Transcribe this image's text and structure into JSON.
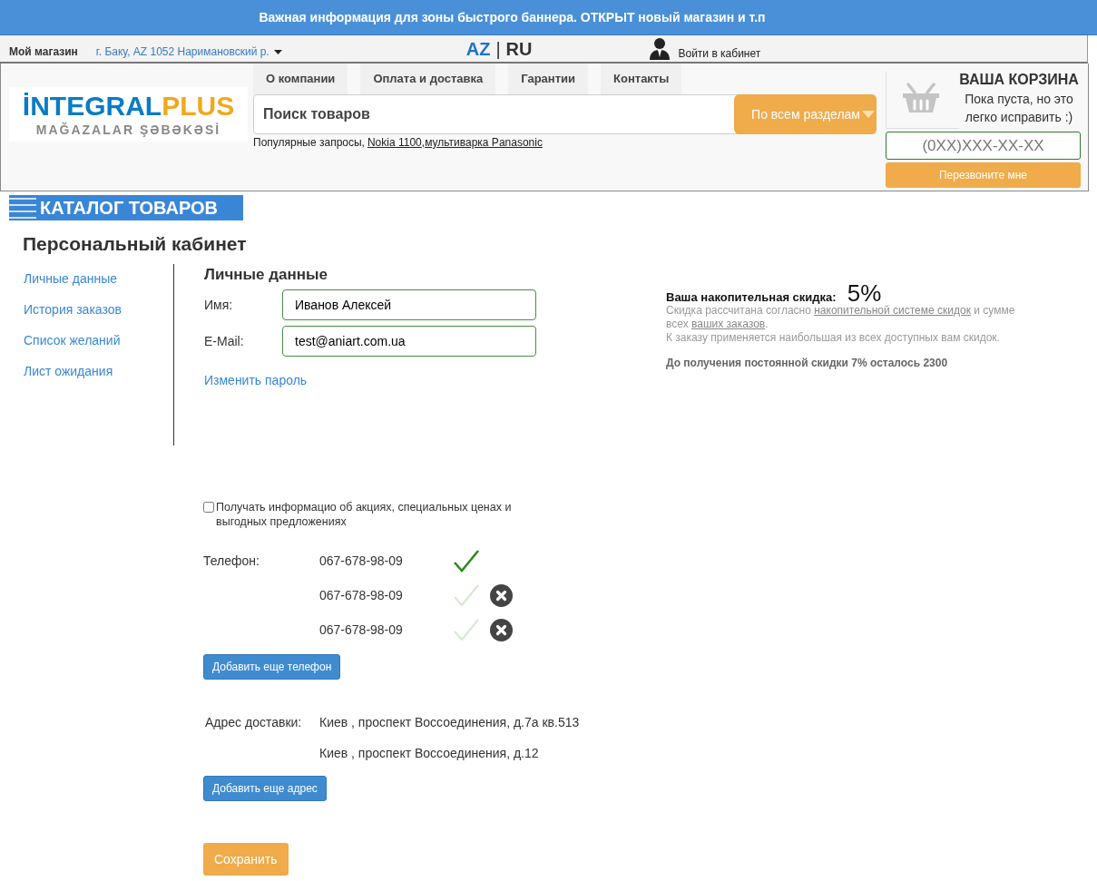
{
  "banner": {
    "text": "Важная информация для зоны быстрого баннера. ОТКРЫТ новый магазин и т.п"
  },
  "store_bar": {
    "label": "Мой магазин",
    "location": "г. Баку, AZ 1052 Наримановский р.",
    "languages": [
      {
        "label": "AZ",
        "selected": true
      },
      {
        "label": "RU",
        "selected": false
      }
    ],
    "separator": "|",
    "login": "Войти в кабинет"
  },
  "logo": {
    "primary": "İNTEGRAL",
    "accent": "PLUS",
    "tagline": "MAĞAZALAR ŞƏBƏKƏSİ"
  },
  "nav": [
    "О компании",
    "Оплата и доставка",
    "Гарантии",
    "Контакты"
  ],
  "search": {
    "placeholder": "Поиск товаров",
    "scope": "По всем разделам",
    "popular_label": "Популярные запросы,",
    "separator": ",",
    "popular": [
      "Nokia 1100",
      "мультиварка Panasonic"
    ]
  },
  "cart": {
    "title": "ВАША КОРЗИНА",
    "text": "Пока пуста, но это легко исправить :)"
  },
  "callback": {
    "placeholder": "(0XX)XXX-XX-XX",
    "button": "Перезвоните мне"
  },
  "catalog": {
    "label": "КАТАЛОГ ТОВАРОВ"
  },
  "page_title": "Персональный кабинет",
  "sidebar": {
    "items": [
      {
        "label": "Личные данные"
      },
      {
        "label": "История заказов"
      },
      {
        "label": "Список желаний"
      },
      {
        "label": "Лист ожидания"
      }
    ]
  },
  "personal": {
    "title": "Личные данные",
    "fields": [
      {
        "label": "Имя:",
        "value": "Иванов Алексей"
      },
      {
        "label": "E-Mail:",
        "value": "test@aniart.com.ua"
      }
    ],
    "change_password": "Изменить пароль"
  },
  "discount": {
    "label": "Ваша накопительная скидка:",
    "value": "5%",
    "note_before": "Скидка рассчитана согласно ",
    "note_link1": "накопительной системе скидок",
    "note_middle": " и сумме всех ",
    "note_link2": "ваших заказов",
    "note_after": ".",
    "note2": "К заказу применяется наибольшая из всех доступных вам скидок.",
    "remaining": "До получения постоянной скидки 7% осталось 2300"
  },
  "subscribe": {
    "label": "Получать информацио об акциях, специальных ценах и выгодных предложениях",
    "checked": false
  },
  "phones": {
    "label": "Телефон:",
    "items": [
      {
        "number": "067-678-98-09",
        "primary": true,
        "removable": false
      },
      {
        "number": "067-678-98-09",
        "primary": false,
        "removable": true
      },
      {
        "number": "067-678-98-09",
        "primary": false,
        "removable": true
      }
    ],
    "add_button": "Добавить еще телефон"
  },
  "addresses": {
    "label": "Адрес доставки:",
    "items": [
      "Киев , проспект Воссоединения, д.7а кв.513",
      "Киев , проспект Воссоединения, д.12"
    ],
    "add_button": "Добавить еще адрес"
  },
  "save_button": "Сохранить"
}
